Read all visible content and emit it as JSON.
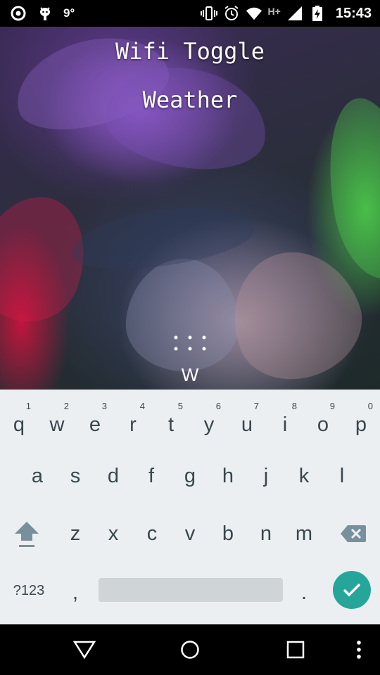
{
  "status_bar": {
    "left_icons": [
      "app-logo-icon",
      "android-bug-icon"
    ],
    "temperature": "9°",
    "right_icons": [
      "vibrate-icon",
      "alarm-icon",
      "wifi-icon",
      "signal-icon",
      "battery-charging-icon"
    ],
    "network": "H+",
    "time": "15:43"
  },
  "wallpaper": {
    "title_line1": "Wifi Toggle",
    "title_line2": "Weather",
    "typed_text": "W"
  },
  "keyboard": {
    "row1": [
      {
        "hint": "1",
        "key": "q"
      },
      {
        "hint": "2",
        "key": "w"
      },
      {
        "hint": "3",
        "key": "e"
      },
      {
        "hint": "4",
        "key": "r"
      },
      {
        "hint": "5",
        "key": "t"
      },
      {
        "hint": "6",
        "key": "y"
      },
      {
        "hint": "7",
        "key": "u"
      },
      {
        "hint": "8",
        "key": "i"
      },
      {
        "hint": "9",
        "key": "o"
      },
      {
        "hint": "0",
        "key": "p"
      }
    ],
    "row2": [
      "a",
      "s",
      "d",
      "f",
      "g",
      "h",
      "j",
      "k",
      "l"
    ],
    "row3": [
      "z",
      "x",
      "c",
      "v",
      "b",
      "n",
      "m"
    ],
    "symbols_label": "?123",
    "comma": ",",
    "period": ".",
    "accent_color": "#26a69a",
    "background_color": "#eceff1"
  },
  "nav_bar": {
    "buttons": [
      "back-icon",
      "home-icon",
      "recents-icon",
      "overflow-menu-icon"
    ]
  }
}
